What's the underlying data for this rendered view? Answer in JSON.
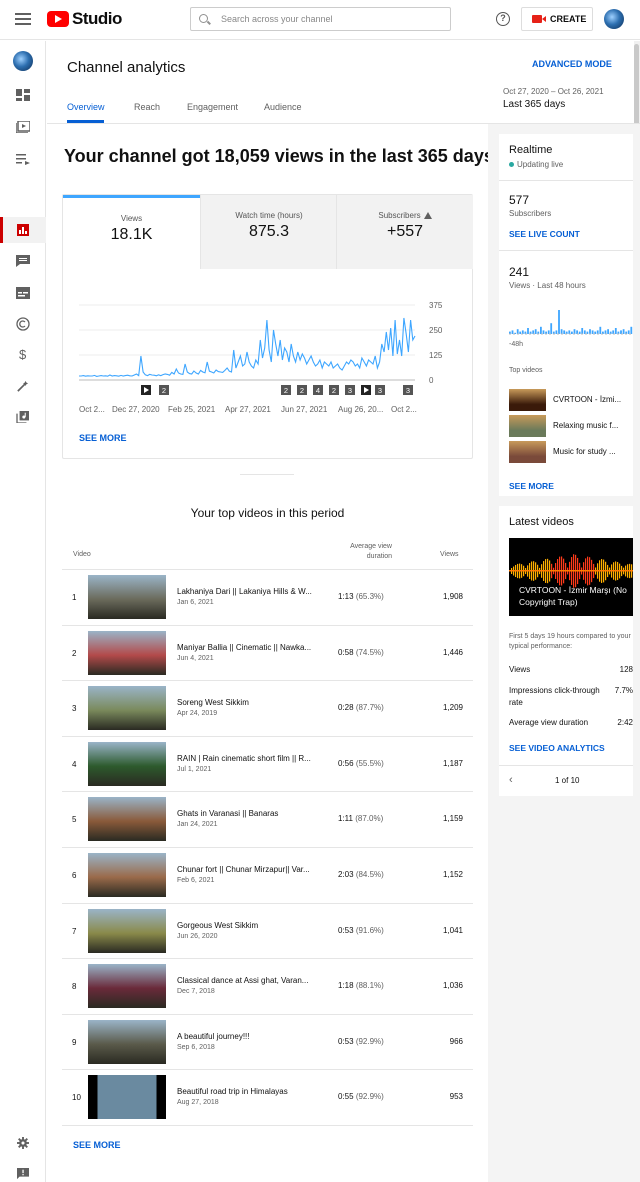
{
  "app": {
    "logo_text": "Studio"
  },
  "search": {
    "placeholder": "Search across your channel"
  },
  "header": {
    "create_label": "CREATE",
    "page_title": "Channel analytics",
    "advanced_mode": "ADVANCED MODE",
    "date_range": "Oct 27, 2020 – Oct 26, 2021",
    "date_label": "Last 365 days",
    "tabs": [
      {
        "label": "Overview",
        "active": true
      },
      {
        "label": "Reach",
        "active": false
      },
      {
        "label": "Engagement",
        "active": false
      },
      {
        "label": "Audience",
        "active": false
      }
    ]
  },
  "sidebar": {
    "icons": [
      "dashboard-icon",
      "content-icon",
      "playlists-icon",
      "analytics-icon",
      "comments-icon",
      "subtitles-icon",
      "copyright-icon",
      "monetization-icon",
      "customization-icon",
      "audio-library-icon",
      "settings-icon",
      "feedback-icon"
    ]
  },
  "summary": {
    "headline": "Your channel got 18,059 views in the last 365 days",
    "metrics": [
      {
        "label": "Views",
        "value": "18.1K"
      },
      {
        "label": "Watch time (hours)",
        "value": "875.3"
      },
      {
        "label": "Subscribers",
        "value": "+557"
      }
    ],
    "see_more": "SEE MORE"
  },
  "chart_data": {
    "type": "line",
    "title": "",
    "ylabel": "",
    "xlabel": "",
    "y_ticks": [
      0,
      125,
      250,
      375
    ],
    "ylim": [
      0,
      375
    ],
    "x_tick_labels": [
      "Oct 2...",
      "Dec 27, 2020",
      "Feb 25, 2021",
      "Apr 27, 2021",
      "Jun 27, 2021",
      "Aug 26, 20...",
      "Oct 2..."
    ],
    "color": "#3ea6ff",
    "series": [
      {
        "name": "",
        "values": [
          20,
          20,
          22,
          19,
          21,
          20,
          20,
          23,
          18,
          20,
          22,
          20,
          21,
          19,
          25,
          20,
          22,
          21,
          19,
          23,
          20,
          22,
          24,
          21,
          20,
          25,
          30,
          22,
          120,
          40,
          26,
          22,
          28,
          25,
          24,
          21,
          26,
          22,
          27,
          30,
          28,
          24,
          38,
          30,
          55,
          35,
          30,
          28,
          80,
          40,
          32,
          30,
          45,
          35,
          30,
          48,
          40,
          36,
          90,
          44,
          40,
          35,
          50,
          42,
          40,
          38,
          48,
          60,
          44,
          40,
          150,
          60,
          90,
          120,
          70,
          80,
          140,
          90,
          70,
          60,
          100,
          80,
          200,
          110,
          160,
          300,
          150,
          90,
          250,
          180,
          120,
          200,
          100,
          160,
          140,
          90,
          180,
          120,
          90,
          140,
          100,
          130,
          110,
          80,
          100,
          120,
          90,
          70,
          80,
          100,
          60,
          90,
          80,
          70,
          90,
          60,
          70,
          80,
          60,
          50,
          70,
          90,
          80,
          100,
          90,
          70,
          80,
          60,
          110,
          90,
          70,
          100,
          90,
          80,
          120,
          60,
          90,
          180,
          140,
          240,
          150,
          260,
          120,
          300,
          130,
          200,
          120,
          310,
          230,
          140,
          300,
          200,
          220
        ]
      }
    ],
    "annotation_markers": [
      {
        "kind": "play",
        "label": ""
      },
      {
        "kind": "count",
        "label": "2"
      },
      {
        "kind": "count",
        "label": "2"
      },
      {
        "kind": "count",
        "label": "2"
      },
      {
        "kind": "count",
        "label": "4"
      },
      {
        "kind": "count",
        "label": "2"
      },
      {
        "kind": "count",
        "label": "3"
      },
      {
        "kind": "play",
        "label": ""
      },
      {
        "kind": "count",
        "label": "3"
      },
      {
        "kind": "count",
        "label": "3"
      }
    ]
  },
  "top_videos": {
    "title": "Your top videos in this period",
    "col_video": "Video",
    "col_avd": "Average view duration",
    "col_views": "Views",
    "rows": [
      {
        "rank": "1",
        "title": "Lakhaniya Dari || Lakaniya Hills & W...",
        "date": "Jan 6, 2021",
        "avd": "1:13",
        "pct": "(65.3%)",
        "views": "1,908",
        "thumb": "#6b6b5c"
      },
      {
        "rank": "2",
        "title": "Maniyar Ballia || Cinematic || Nawka...",
        "date": "Jun 4, 2021",
        "avd": "0:58",
        "pct": "(74.5%)",
        "views": "1,446",
        "thumb": "#b34a4a"
      },
      {
        "rank": "3",
        "title": "Soreng West Sikkim",
        "date": "Apr 24, 2019",
        "avd": "0:28",
        "pct": "(87.7%)",
        "views": "1,209",
        "thumb": "#7a8a5c"
      },
      {
        "rank": "4",
        "title": "RAIN | Rain cinematic short film || R...",
        "date": "Jul 1, 2021",
        "avd": "0:56",
        "pct": "(55.5%)",
        "views": "1,187",
        "thumb": "#2d5a2d"
      },
      {
        "rank": "5",
        "title": "Ghats in Varanasi || Banaras",
        "date": "Jan 24, 2021",
        "avd": "1:11",
        "pct": "(87.0%)",
        "views": "1,159",
        "thumb": "#8a5a3a"
      },
      {
        "rank": "6",
        "title": "Chunar fort || Chunar Mirzapur|| Var...",
        "date": "Feb 6, 2021",
        "avd": "2:03",
        "pct": "(84.5%)",
        "views": "1,152",
        "thumb": "#9a6a4a"
      },
      {
        "rank": "7",
        "title": "Gorgeous West Sikkim",
        "date": "Jun 26, 2020",
        "avd": "0:53",
        "pct": "(91.6%)",
        "views": "1,041",
        "thumb": "#8a8a4a"
      },
      {
        "rank": "8",
        "title": "Classical dance at Assi ghat, Varan...",
        "date": "Dec 7, 2018",
        "avd": "1:18",
        "pct": "(88.1%)",
        "views": "1,036",
        "thumb": "#6a2a3a"
      },
      {
        "rank": "9",
        "title": "A beautiful journey!!!",
        "date": "Sep 6, 2018",
        "avd": "0:53",
        "pct": "(92.9%)",
        "views": "966",
        "thumb": "#5a5a4a"
      },
      {
        "rank": "10",
        "title": "Beautiful road trip in Himalayas",
        "date": "Aug 27, 2018",
        "avd": "0:55",
        "pct": "(92.9%)",
        "views": "953",
        "thumb": "#3a5a6a"
      }
    ],
    "see_more": "SEE MORE"
  },
  "realtime": {
    "title": "Realtime",
    "status": "Updating live",
    "subscribers_value": "577",
    "subscribers_label": "Subscribers",
    "see_live_count": "SEE LIVE COUNT",
    "views_value": "241",
    "views_label": "Views · Last 48 hours",
    "axis_label": "-48h",
    "bars": [
      2,
      3,
      1,
      4,
      2,
      3,
      2,
      5,
      2,
      3,
      4,
      2,
      6,
      3,
      2,
      3,
      9,
      2,
      3,
      20,
      4,
      3,
      2,
      3,
      2,
      4,
      3,
      2,
      5,
      3,
      2,
      4,
      3,
      2,
      3,
      6,
      2,
      3,
      4,
      2,
      3,
      5,
      2,
      3,
      4,
      2,
      3,
      6
    ],
    "top_videos_label": "Top videos",
    "top_videos": [
      {
        "title": "CVRTOON - İzmi...",
        "thumb": "#3a1a0a"
      },
      {
        "title": "Relaxing music f...",
        "thumb": "#6a7a5a"
      },
      {
        "title": "Music for study ...",
        "thumb": "#7a4a3a"
      }
    ],
    "see_more": "SEE MORE"
  },
  "latest": {
    "title": "Latest videos",
    "video_title": "CVRTOON - İzmir Marşı (No Copyright Trap)",
    "compare_text": "First 5 days 19 hours compared to your typical performance:",
    "stats": [
      {
        "label": "Views",
        "value": "128"
      },
      {
        "label": "Impressions click-through rate",
        "value": "7.7%"
      },
      {
        "label": "Average view duration",
        "value": "2:42"
      }
    ],
    "see_analytics": "SEE VIDEO ANALYTICS",
    "pager": "1 of 10"
  }
}
